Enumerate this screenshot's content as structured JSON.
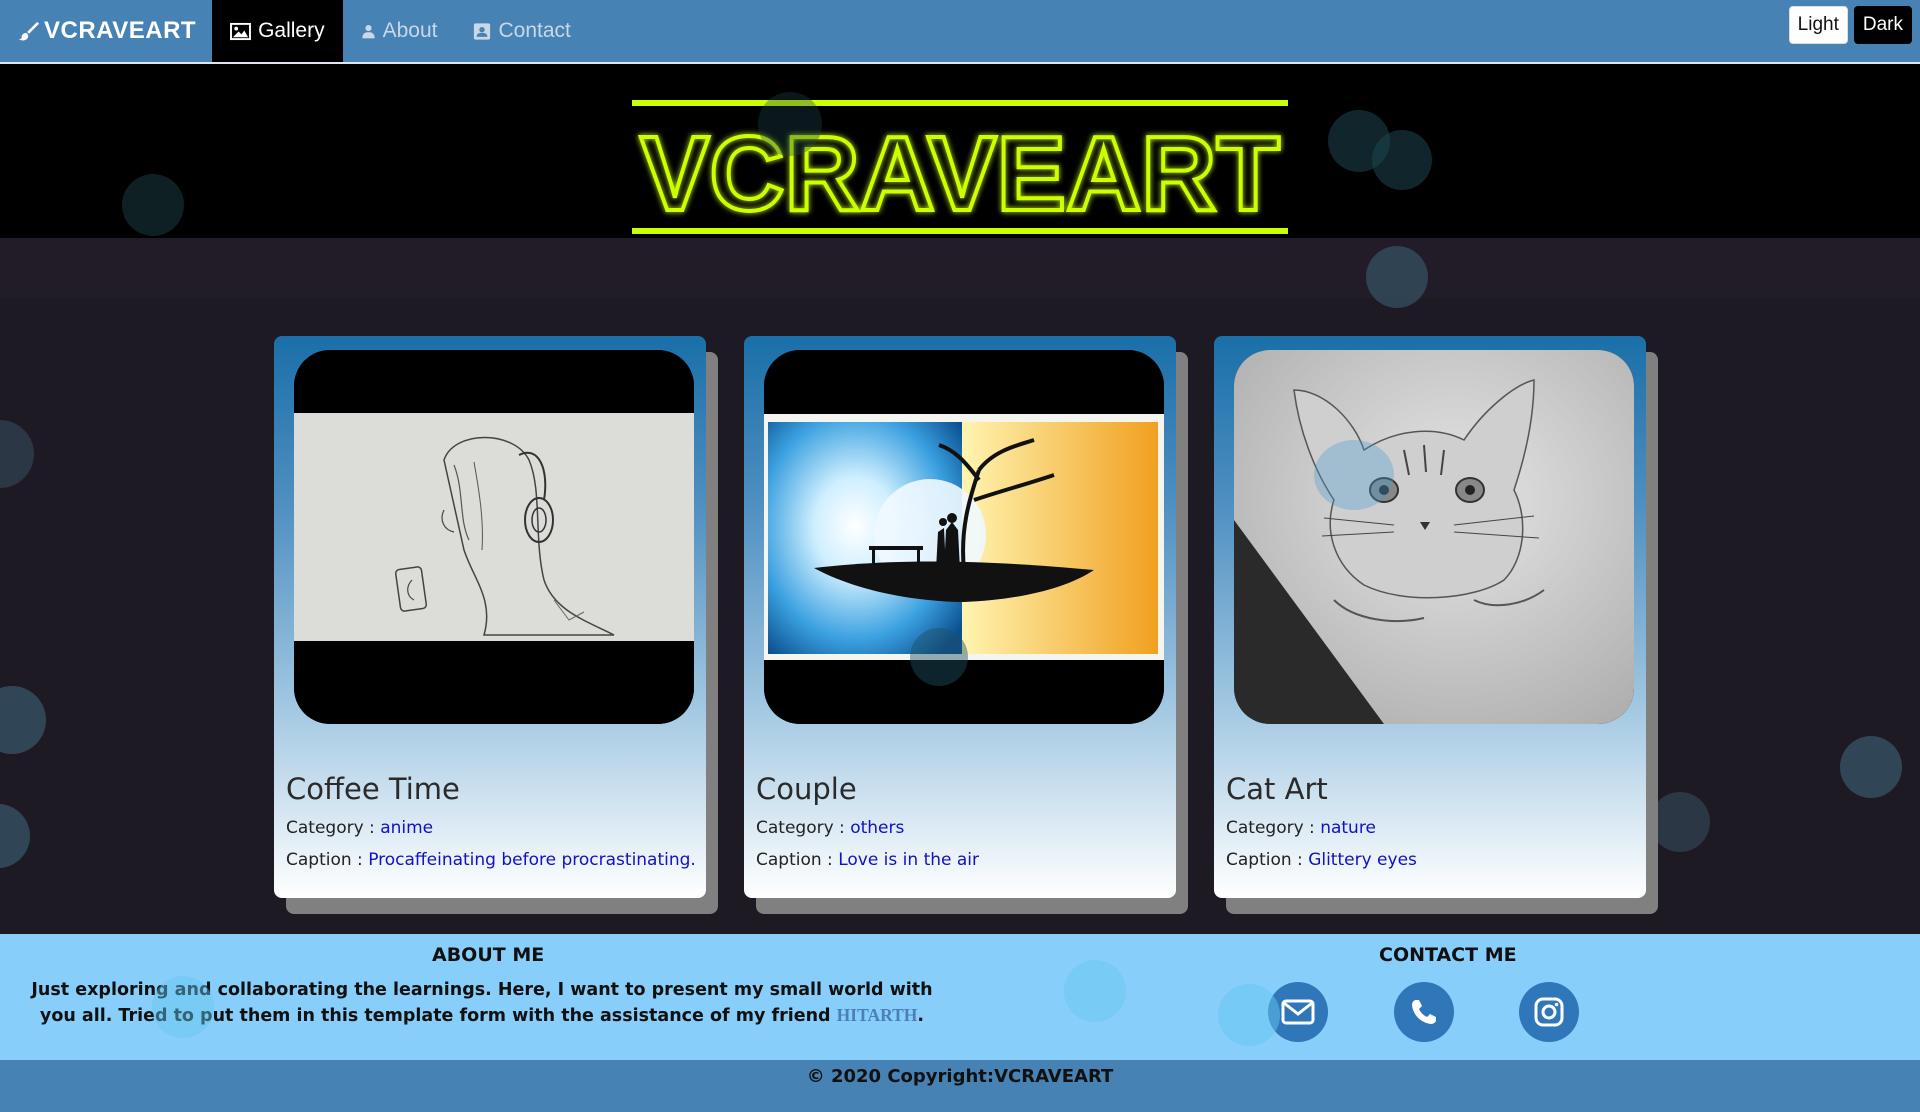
{
  "nav": {
    "brand": "VCRAVEART",
    "items": [
      {
        "label": "Gallery",
        "icon": "image-icon",
        "active": true
      },
      {
        "label": "About",
        "icon": "user-icon",
        "active": false
      },
      {
        "label": "Contact",
        "icon": "contact-card-icon",
        "active": false
      }
    ],
    "theme": {
      "light_label": "Light",
      "dark_label": "Dark"
    }
  },
  "hero": {
    "logo_text": "VCRAVEART",
    "logo_color": "#ccff00"
  },
  "gallery": [
    {
      "title": "Coffee Time",
      "category_label": "Category : ",
      "category": "anime",
      "caption_label": "Caption : ",
      "caption": "Procaffeinating before procrastinating."
    },
    {
      "title": "Couple",
      "category_label": "Category : ",
      "category": "others",
      "caption_label": "Caption : ",
      "caption": "Love is in the air"
    },
    {
      "title": "Cat Art",
      "category_label": "Category : ",
      "category": "nature",
      "caption_label": "Caption : ",
      "caption": "Glittery eyes"
    }
  ],
  "footer": {
    "about_heading": "ABOUT ME",
    "about_text": "Just exploring and collaborating the learnings. Here, I want to present my small world with you all. Tried to put them in this template form with the assistance of my friend ",
    "about_friend": "HITARTH",
    "about_end": ".",
    "contact_heading": "CONTACT ME",
    "social_icons": [
      "envelope-icon",
      "phone-icon",
      "instagram-icon"
    ],
    "copyright": "© 2020 Copyright:VCRAVEART"
  },
  "colors": {
    "navbar": "#4682b4",
    "footer": "#87cefa",
    "link": "#1010c8",
    "page_bg": "#1e1a24"
  }
}
